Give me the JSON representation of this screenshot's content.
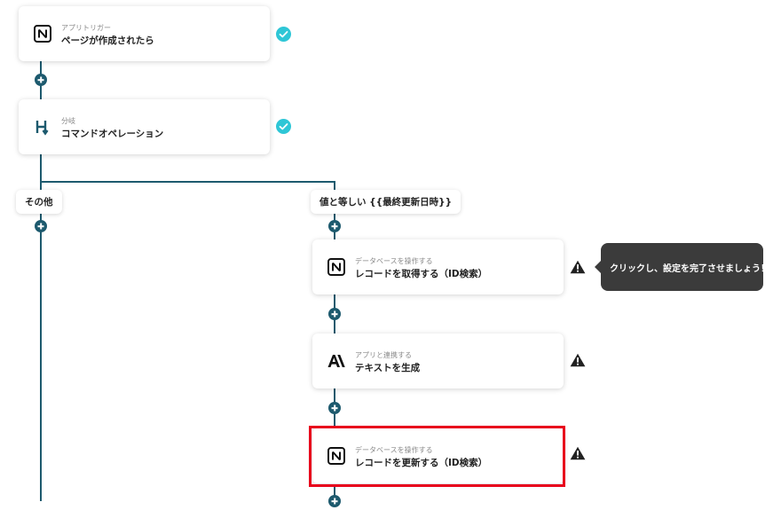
{
  "flow": {
    "trigger": {
      "sublabel": "アプリトリガー",
      "label": "ページが作成されたら",
      "icon": "notion-icon",
      "status": "complete"
    },
    "branch": {
      "sublabel": "分岐",
      "label": "コマンドオペレーション",
      "icon": "branch-icon",
      "status": "complete"
    },
    "branch_left": {
      "label": "その他"
    },
    "branch_right": {
      "label": "値と等しい {{最終更新日時}}"
    },
    "steps": [
      {
        "sublabel": "データベースを操作する",
        "label": "レコードを取得する（ID検索）",
        "icon": "notion-icon",
        "status": "warning"
      },
      {
        "sublabel": "アプリと連携する",
        "label": "テキストを生成",
        "icon": "anthropic-icon",
        "status": "warning"
      },
      {
        "sublabel": "データベースを操作する",
        "label": "レコードを更新する（ID検索）",
        "icon": "notion-icon",
        "status": "warning",
        "highlighted": true
      }
    ],
    "tooltip": "クリックし、設定を完了させましょう！"
  },
  "colors": {
    "connector": "#1d5a6e",
    "check": "#2ec6d6",
    "warning": "#222222",
    "highlight": "#e8001c",
    "tooltip_bg": "#3b3b3b"
  }
}
